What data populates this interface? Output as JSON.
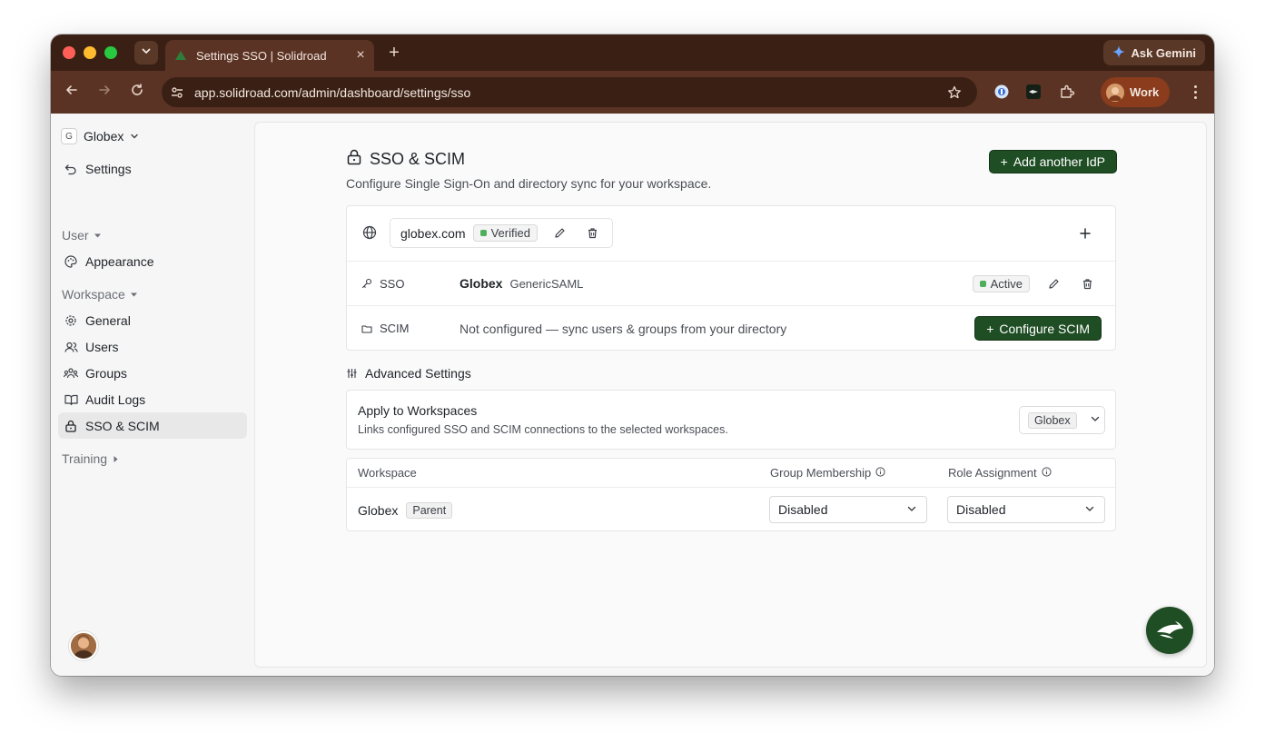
{
  "browser": {
    "tab_title": "Settings SSO | Solidroad",
    "ask_gemini": "Ask Gemini",
    "url": "app.solidroad.com/admin/dashboard/settings/sso",
    "profile_label": "Work"
  },
  "sidebar": {
    "workspace_badge": "G",
    "workspace_name": "Globex",
    "back_label": "Settings",
    "user_section": "User",
    "appearance": "Appearance",
    "workspace_section": "Workspace",
    "items": [
      "General",
      "Users",
      "Groups",
      "Audit Logs",
      "SSO & SCIM"
    ],
    "training_section": "Training"
  },
  "page": {
    "title": "SSO & SCIM",
    "subtitle": "Configure Single Sign-On and directory sync for your workspace.",
    "add_idp": "Add another IdP"
  },
  "domain": {
    "name": "globex.com",
    "status": "Verified"
  },
  "sso": {
    "type": "SSO",
    "provider_name": "Globex",
    "provider_kind": "GenericSAML",
    "status": "Active"
  },
  "scim": {
    "type": "SCIM",
    "description": "Not configured — sync users & groups from your directory",
    "configure": "Configure SCIM"
  },
  "advanced": {
    "heading": "Advanced Settings",
    "apply_title": "Apply to Workspaces",
    "apply_sub": "Links configured SSO and SCIM connections to the selected workspaces.",
    "selected": "Globex"
  },
  "table": {
    "headers": [
      "Workspace",
      "Group Membership",
      "Role Assignment"
    ],
    "row": {
      "workspace": "Globex",
      "tag": "Parent",
      "group_membership": "Disabled",
      "role_assignment": "Disabled"
    }
  },
  "colors": {
    "brand_green": "#1f4d24",
    "status_green": "#4fae5c",
    "browser_frame": "#3a2014"
  }
}
